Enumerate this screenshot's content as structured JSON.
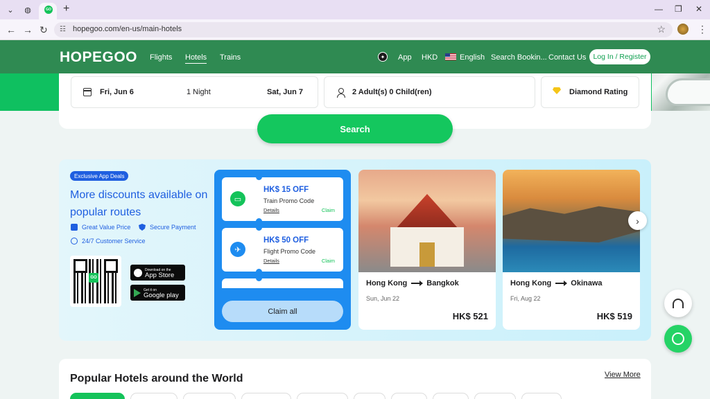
{
  "browser": {
    "tab_favicon": "GO",
    "url": "hopegoo.com/en-us/main-hotels"
  },
  "header": {
    "logo": "HOPEGOO",
    "nav": [
      "Flights",
      "Hotels",
      "Trains"
    ],
    "active_nav": "Hotels",
    "app": "App",
    "currency": "HKD",
    "language": "English",
    "search_bookings": "Search Bookin...",
    "contact": "Contact Us",
    "login": "Log In / Register"
  },
  "search": {
    "check_in": "Fri, Jun 6",
    "nights": "1 Night",
    "check_out": "Sat, Jun 7",
    "guests": "2 Adult(s) 0 Child(ren)",
    "rating": "Diamond Rating",
    "button": "Search"
  },
  "deals": {
    "badge": "Exclusive App Deals",
    "title": "More discounts available on popular routes",
    "features": [
      "Great Value Price",
      "Secure Payment",
      "24/7 Customer Service"
    ],
    "qr_logo": "GO",
    "app_store": {
      "small": "Download on the",
      "big": "App Store"
    },
    "google_play": {
      "small": "Get it on",
      "big": "Google play"
    },
    "coupons": [
      {
        "amount": "HK$ 15 OFF",
        "label": "Train Promo Code",
        "details": "Details",
        "claim": "Claim",
        "icon": "train-icon"
      },
      {
        "amount": "HK$ 50 OFF",
        "label": "Flight Promo Code",
        "details": "Details",
        "claim": "Claim",
        "icon": "plane-icon"
      }
    ],
    "claim_all": "Claim all",
    "routes": [
      {
        "from": "Hong Kong",
        "to": "Bangkok",
        "date": "Sun, Jun 22",
        "price": "HK$ 521"
      },
      {
        "from": "Hong Kong",
        "to": "Okinawa",
        "date": "Fri, Aug 22",
        "price": "HK$ 519"
      }
    ]
  },
  "popular": {
    "title": "Popular Hotels around the World",
    "view_more": "View More"
  },
  "colors": {
    "brand_green": "#14c35a",
    "accent_blue": "#1f5fe0"
  }
}
